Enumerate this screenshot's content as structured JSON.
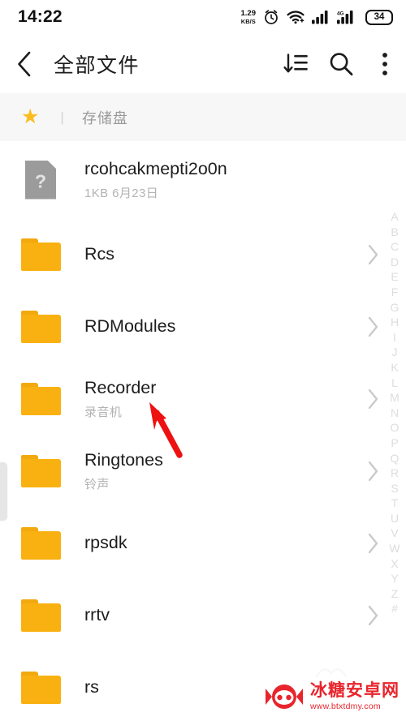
{
  "status_bar": {
    "time": "14:22",
    "net_speed_value": "1.29",
    "net_speed_unit": "KB/S",
    "alarm_icon": "alarm-clock-icon",
    "wifi_icon": "wifi-icon",
    "signal1_icon": "signal-bars-icon",
    "signal2_icon": "signal-bars-4g-icon",
    "network_type": "4G",
    "battery_level": "34"
  },
  "title_bar": {
    "back_icon": "back-chevron-icon",
    "title": "全部文件",
    "sort_icon": "sort-icon",
    "search_icon": "search-icon",
    "more_icon": "more-vertical-icon"
  },
  "breadcrumb": {
    "star_icon": "star-icon",
    "star_glyph": "★",
    "separator": "|",
    "path": "存储盘"
  },
  "file_list": [
    {
      "name": "rcohcakmepti2o0n",
      "meta": "1KB  6月23日",
      "icon": "unknown-file-icon",
      "icon_glyph": "?",
      "type": "file",
      "has_chevron": false
    },
    {
      "name": "Rcs",
      "meta": "",
      "icon": "folder-icon",
      "type": "folder",
      "has_chevron": true
    },
    {
      "name": "RDModules",
      "meta": "",
      "icon": "folder-icon",
      "type": "folder",
      "has_chevron": true
    },
    {
      "name": "Recorder",
      "meta": "录音机",
      "icon": "folder-icon",
      "type": "folder",
      "has_chevron": true
    },
    {
      "name": "Ringtones",
      "meta": "铃声",
      "icon": "folder-icon",
      "type": "folder",
      "has_chevron": true
    },
    {
      "name": "rpsdk",
      "meta": "",
      "icon": "folder-icon",
      "type": "folder",
      "has_chevron": true
    },
    {
      "name": "rrtv",
      "meta": "",
      "icon": "folder-icon",
      "type": "folder",
      "has_chevron": true
    },
    {
      "name": "rs",
      "meta": "",
      "icon": "folder-icon",
      "type": "folder",
      "has_chevron": false
    }
  ],
  "alpha_index": [
    "A",
    "B",
    "C",
    "D",
    "E",
    "F",
    "G",
    "H",
    "I",
    "J",
    "K",
    "L",
    "M",
    "N",
    "O",
    "P",
    "Q",
    "R",
    "S",
    "T",
    "U",
    "V",
    "W",
    "X",
    "Y",
    "Z",
    "#"
  ],
  "annotation": {
    "arrow_icon": "red-arrow-icon",
    "arrow_color": "#ee1111",
    "points_to": "Recorder"
  },
  "watermark": {
    "logo_icon": "candy-game-controller-logo-icon",
    "site_name": "冰糖安卓网",
    "site_url": "www.btxtdmy.com"
  },
  "colors": {
    "folder": "#f9b111",
    "folder_tab": "#f2a90e",
    "star": "#fbbc1e",
    "crumb_bg": "#f7f7f7",
    "text_primary": "#1d1d1d",
    "text_secondary": "#b3b3b3",
    "index": "#dddddd",
    "accent_red": "#e8242c"
  }
}
